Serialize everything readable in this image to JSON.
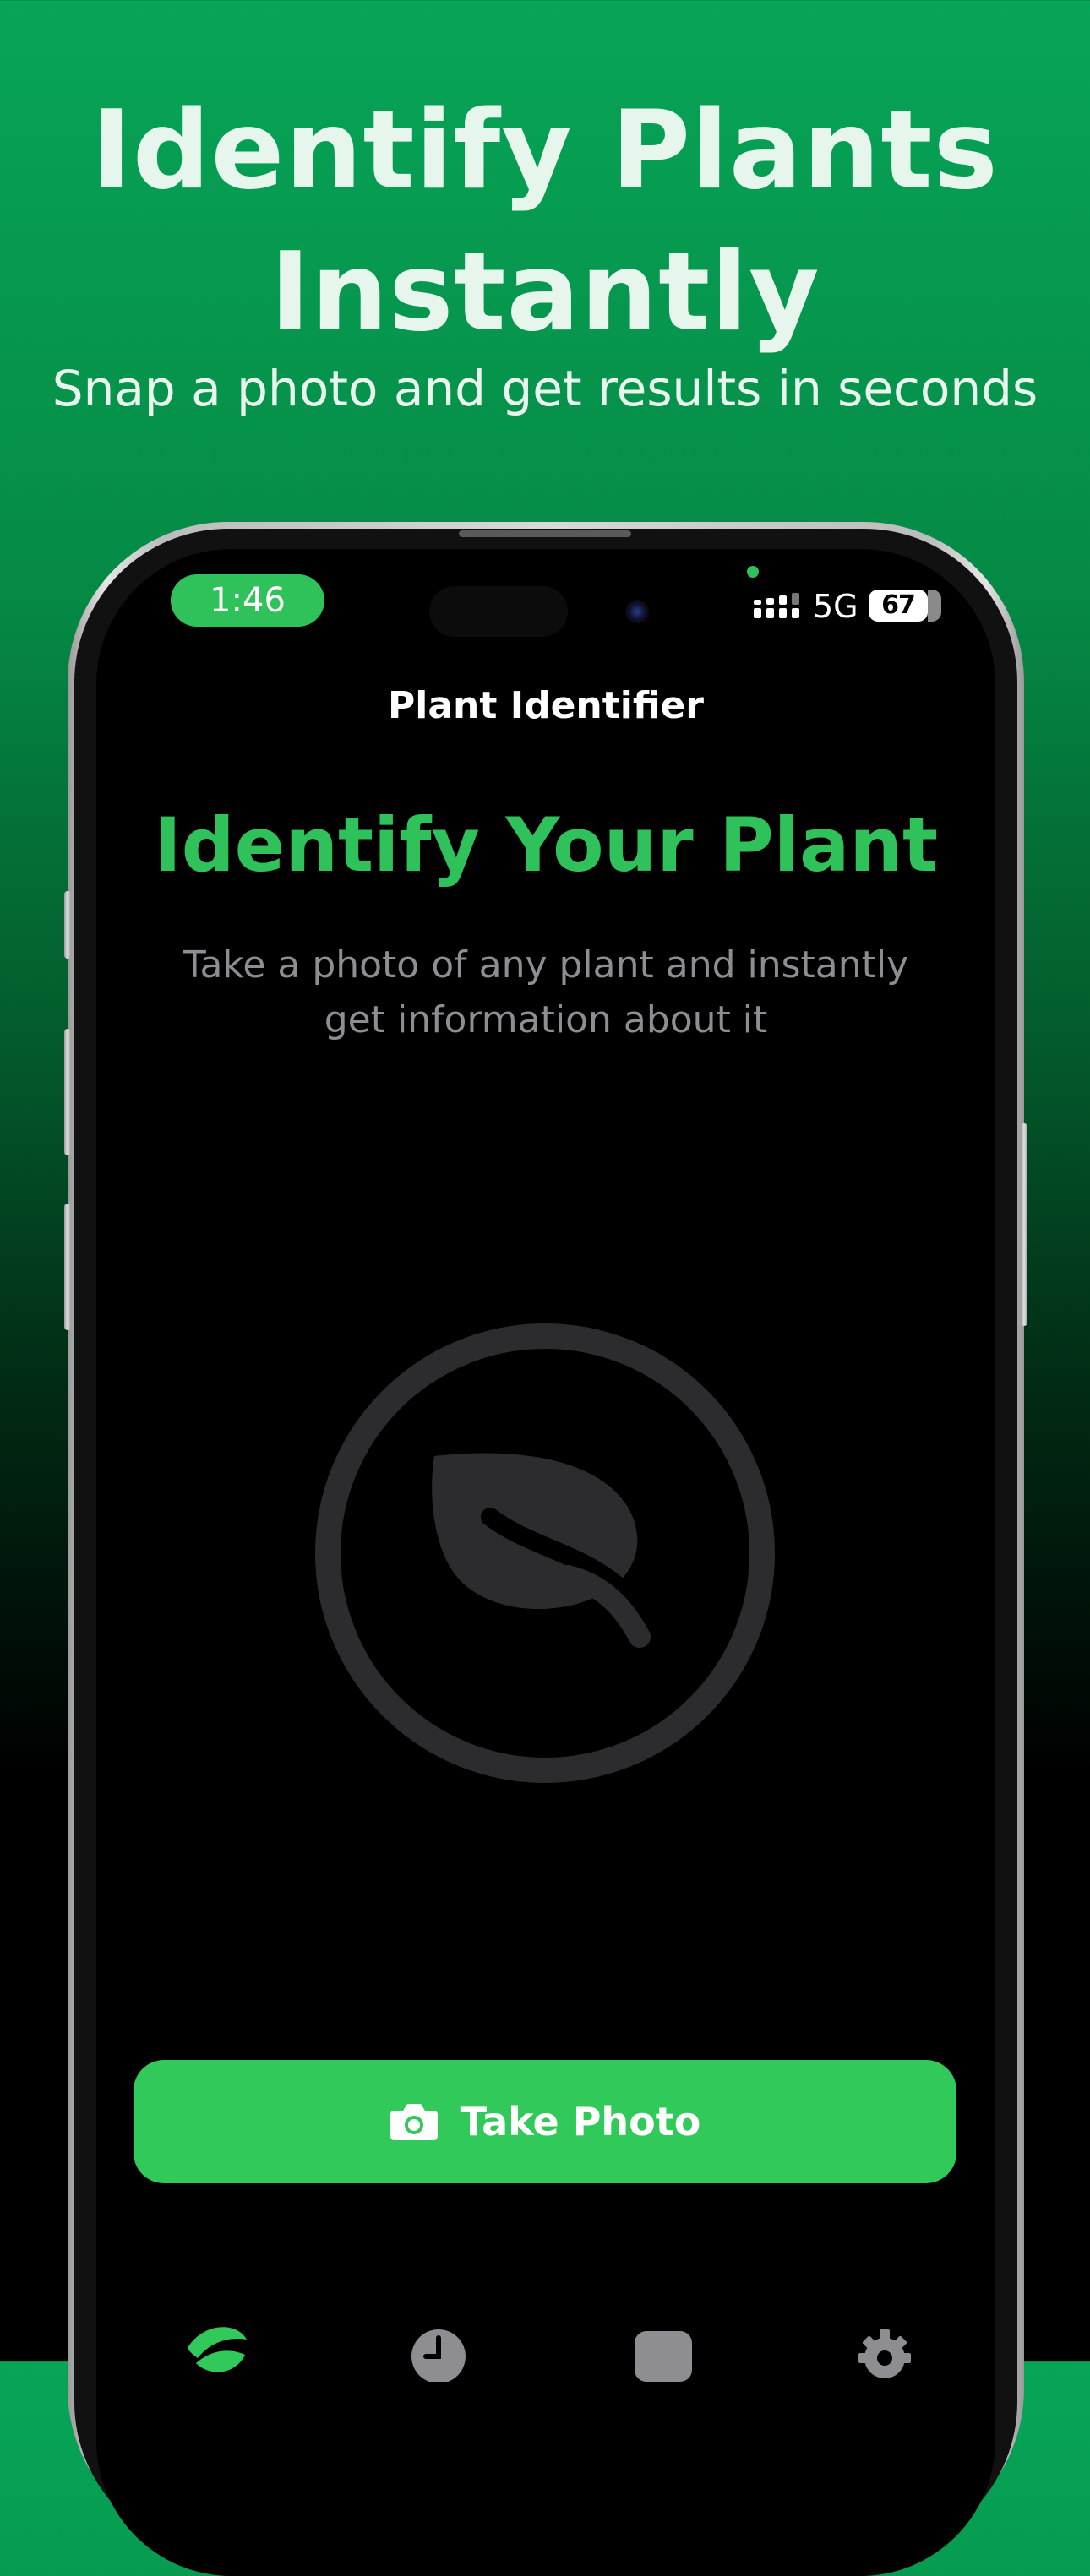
{
  "marketing": {
    "headline_line1": "Identify Plants",
    "headline_line2": "Instantly",
    "subheadline": "Snap a photo and get results in seconds"
  },
  "status_bar": {
    "time": "1:46",
    "network": "5G",
    "battery": "67"
  },
  "screen": {
    "nav_title": "Plant Identifier",
    "heading": "Identify Your Plant",
    "description": "Take a photo of any plant and instantly get information about it",
    "illustration_icon": "leaf-icon",
    "take_photo_label": "Take Photo",
    "take_photo_icon": "camera-icon"
  },
  "tab_bar": {
    "items": [
      {
        "icon": "leaf-icon",
        "active": true
      },
      {
        "icon": "clock-icon",
        "active": false
      },
      {
        "icon": "collection-icon",
        "active": false
      },
      {
        "icon": "gear-icon",
        "active": false
      }
    ]
  },
  "colors": {
    "accent": "#30c95a",
    "background_top": "#07a557",
    "screen_background": "#000000",
    "muted_text": "#8d8d92",
    "placeholder_gray": "#2c2c2e"
  }
}
